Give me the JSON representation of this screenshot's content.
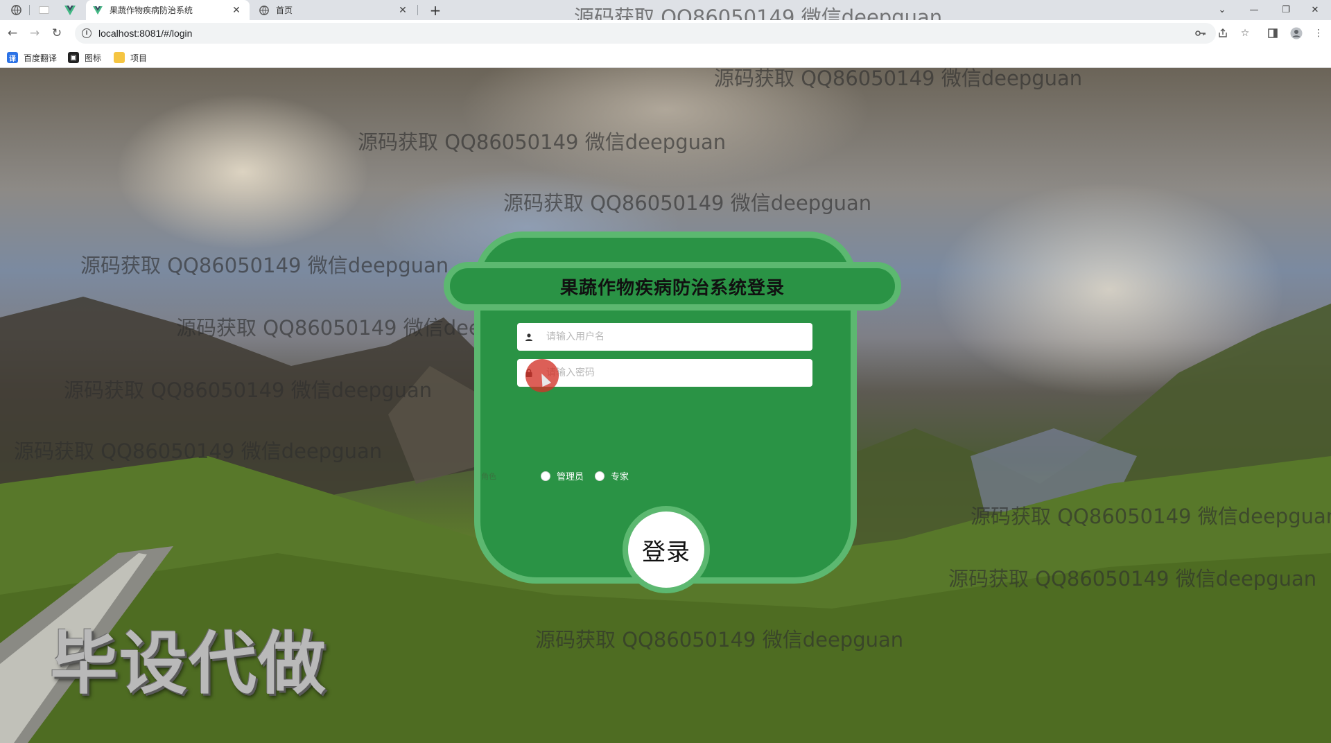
{
  "browser": {
    "tabs": [
      {
        "title": "果蔬作物疾病防治系统",
        "active": true
      },
      {
        "title": "首页",
        "active": false
      }
    ],
    "url": "localhost:8081/#/login",
    "bookmarks": [
      {
        "label": "百度翻译"
      },
      {
        "label": "图标"
      },
      {
        "label": "项目"
      }
    ]
  },
  "watermark": {
    "text": "源码获取 QQ86050149 微信deepguan",
    "big_text": "毕设代做"
  },
  "login": {
    "title": "果蔬作物疾病防治系统登录",
    "username_placeholder": "请输入用户名",
    "password_placeholder": "请输入密码",
    "role_label": "角色",
    "roles": [
      {
        "label": "管理员"
      },
      {
        "label": "专家"
      }
    ],
    "submit_label": "登录"
  },
  "colors": {
    "card_green": "#2a9345",
    "card_border": "#5cb870"
  }
}
